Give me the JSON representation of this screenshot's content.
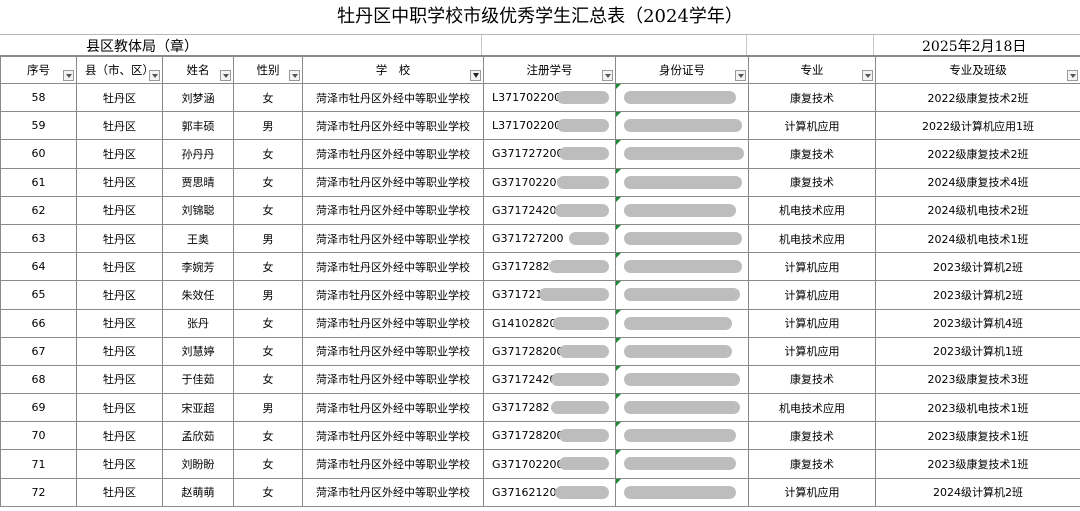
{
  "title": "牡丹区中职学校市级优秀学生汇总表（2024学年）",
  "sub_left": "县区教体局（章）",
  "sub_right": "2025年2月18日",
  "headers": [
    "序号",
    "县（市、区）",
    "姓名",
    "性别",
    "学　校",
    "注册学号",
    "身份证号",
    "专业",
    "专业及班级"
  ],
  "rows": [
    {
      "no": "58",
      "county": "牡丹区",
      "name": "刘梦涵",
      "gender": "女",
      "school": "菏泽市牡丹区外经中等职业学校",
      "reg": "L371702200",
      "major": "康复技术",
      "cls": "2022级康复技术2班"
    },
    {
      "no": "59",
      "county": "牡丹区",
      "name": "郭丰硕",
      "gender": "男",
      "school": "菏泽市牡丹区外经中等职业学校",
      "reg": "L371702200",
      "major": "计算机应用",
      "cls": "2022级计算机应用1班"
    },
    {
      "no": "60",
      "county": "牡丹区",
      "name": "孙丹丹",
      "gender": "女",
      "school": "菏泽市牡丹区外经中等职业学校",
      "reg": "G371727200",
      "major": "康复技术",
      "cls": "2022级康复技术2班"
    },
    {
      "no": "61",
      "county": "牡丹区",
      "name": "贾思晴",
      "gender": "女",
      "school": "菏泽市牡丹区外经中等职业学校",
      "reg": "G371702200",
      "major": "康复技术",
      "cls": "2024级康复技术4班"
    },
    {
      "no": "62",
      "county": "牡丹区",
      "name": "刘锦聪",
      "gender": "女",
      "school": "菏泽市牡丹区外经中等职业学校",
      "reg": "G371724200",
      "major": "机电技术应用",
      "cls": "2024级机电技术2班"
    },
    {
      "no": "63",
      "county": "牡丹区",
      "name": "王奥",
      "gender": "男",
      "school": "菏泽市牡丹区外经中等职业学校",
      "reg": "G371727200",
      "major": "机电技术应用",
      "cls": "2024级机电技术1班"
    },
    {
      "no": "64",
      "county": "牡丹区",
      "name": "李婉芳",
      "gender": "女",
      "school": "菏泽市牡丹区外经中等职业学校",
      "reg": "G3717282",
      "major": "计算机应用",
      "cls": "2023级计算机2班"
    },
    {
      "no": "65",
      "county": "牡丹区",
      "name": "朱效任",
      "gender": "男",
      "school": "菏泽市牡丹区外经中等职业学校",
      "reg": "G371721",
      "major": "计算机应用",
      "cls": "2023级计算机2班"
    },
    {
      "no": "66",
      "county": "牡丹区",
      "name": "张丹",
      "gender": "女",
      "school": "菏泽市牡丹区外经中等职业学校",
      "reg": "G141028200",
      "major": "计算机应用",
      "cls": "2023级计算机4班"
    },
    {
      "no": "67",
      "county": "牡丹区",
      "name": "刘慧婷",
      "gender": "女",
      "school": "菏泽市牡丹区外经中等职业学校",
      "reg": "G3717282008",
      "major": "计算机应用",
      "cls": "2023级计算机1班"
    },
    {
      "no": "68",
      "county": "牡丹区",
      "name": "于佳茹",
      "gender": "女",
      "school": "菏泽市牡丹区外经中等职业学校",
      "reg": "G371724200",
      "major": "康复技术",
      "cls": "2023级康复技术3班"
    },
    {
      "no": "69",
      "county": "牡丹区",
      "name": "宋亚超",
      "gender": "男",
      "school": "菏泽市牡丹区外经中等职业学校",
      "reg": "G3717282",
      "major": "机电技术应用",
      "cls": "2023级机电技术1班"
    },
    {
      "no": "70",
      "county": "牡丹区",
      "name": "孟欣茹",
      "gender": "女",
      "school": "菏泽市牡丹区外经中等职业学校",
      "reg": "G371728200",
      "major": "康复技术",
      "cls": "2023级康复技术1班"
    },
    {
      "no": "71",
      "county": "牡丹区",
      "name": "刘盼盼",
      "gender": "女",
      "school": "菏泽市牡丹区外经中等职业学校",
      "reg": "G371702200",
      "major": "康复技术",
      "cls": "2023级康复技术1班"
    },
    {
      "no": "72",
      "county": "牡丹区",
      "name": "赵萌萌",
      "gender": "女",
      "school": "菏泽市牡丹区外经中等职业学校",
      "reg": "G371621200",
      "major": "计算机应用",
      "cls": "2024级计算机2班"
    }
  ],
  "colors": {
    "redaction": "#bdbdbd",
    "grid": "#8a8a8a",
    "cell_marker": "#1d8a3a"
  },
  "icons": {
    "filter_dropdown": "chevron-down-icon",
    "active_filter": "filter-icon"
  }
}
